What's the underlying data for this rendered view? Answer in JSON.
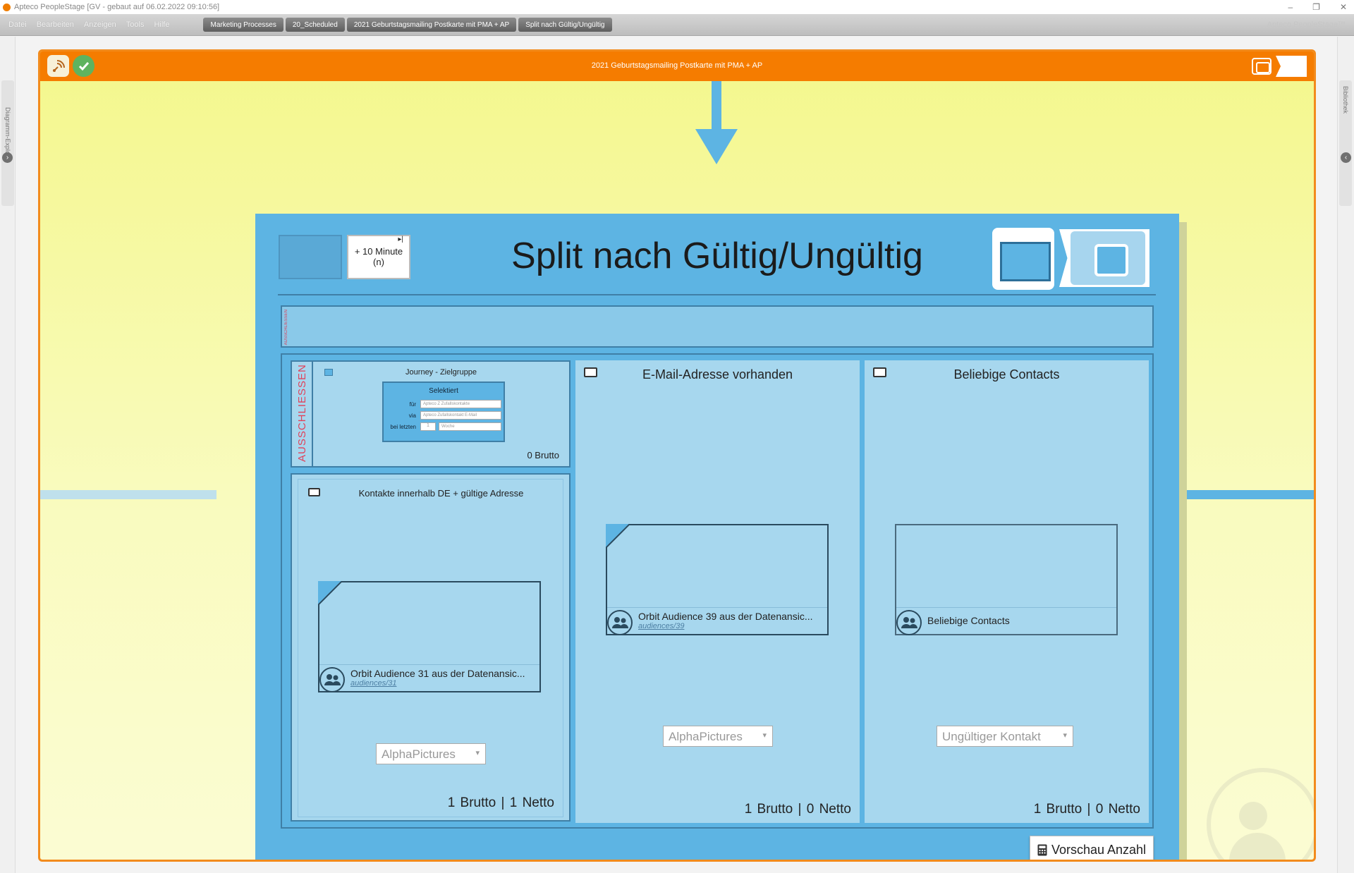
{
  "window": {
    "title": "Apteco PeopleStage [GV - gebaut auf 06.02.2022 09:10:56]",
    "controls": [
      "–",
      "❐",
      "✕"
    ]
  },
  "menu": [
    "Datei",
    "Bearbeiten",
    "Anzeigen",
    "Tools",
    "Hilfe"
  ],
  "breadcrumbs": [
    "Marketing Processes",
    "20_Scheduled",
    "2021 Geburtstagsmailing Postkarte mit PMA + AP",
    "Split nach Gültig/Ungültig"
  ],
  "brand": "Apteco PeopleStage™",
  "left_rail_label": "Diagramm-Explorer",
  "right_rail_label": "Bibliothek",
  "process": {
    "title": "2021 Geburtstagsmailing Postkarte mit PMA + AP",
    "colors": {
      "header": "#f57c00",
      "node": "#5db4e3",
      "panel": "#a7d7ee"
    }
  },
  "split": {
    "title": "Split nach Gültig/Ungültig",
    "delay": "+ 10 Minute (n)",
    "exclude_strip_label": "AUSSCHLIESSEN",
    "exclude": {
      "label": "AUSSCHLIESSEN",
      "journey_title": "Journey - Zielgruppe",
      "selector": {
        "heading": "Selektiert",
        "for_label": "für",
        "for_value": "Apteco Z Zufallskontakte",
        "via_label": "via",
        "via_value": "Apteco Zufallskontakt E-Mail",
        "last_label": "bei letzten",
        "last_number": "1",
        "last_unit": "Woche"
      },
      "count": "0 Brutto"
    },
    "segments": [
      {
        "title": "Kontakte innerhalb DE + gültige Adresse",
        "audience_name": "Orbit Audience 31 aus der Datenansic...",
        "audience_link": "audiences/31",
        "dropdown": "AlphaPictures",
        "counts": "1 Brutto | 1 Netto"
      },
      {
        "title": "E-Mail-Adresse vorhanden",
        "audience_name": "Orbit Audience 39 aus der Datenansic...",
        "audience_link": "audiences/39",
        "dropdown": "AlphaPictures",
        "counts": "1 Brutto | 0 Netto"
      },
      {
        "title": "Beliebige Contacts",
        "audience_name": "Beliebige Contacts",
        "audience_link": "",
        "dropdown": "Ungültiger Kontakt",
        "counts": "1 Brutto | 0 Netto"
      }
    ],
    "preview_button": "Vorschau Anzahl"
  }
}
